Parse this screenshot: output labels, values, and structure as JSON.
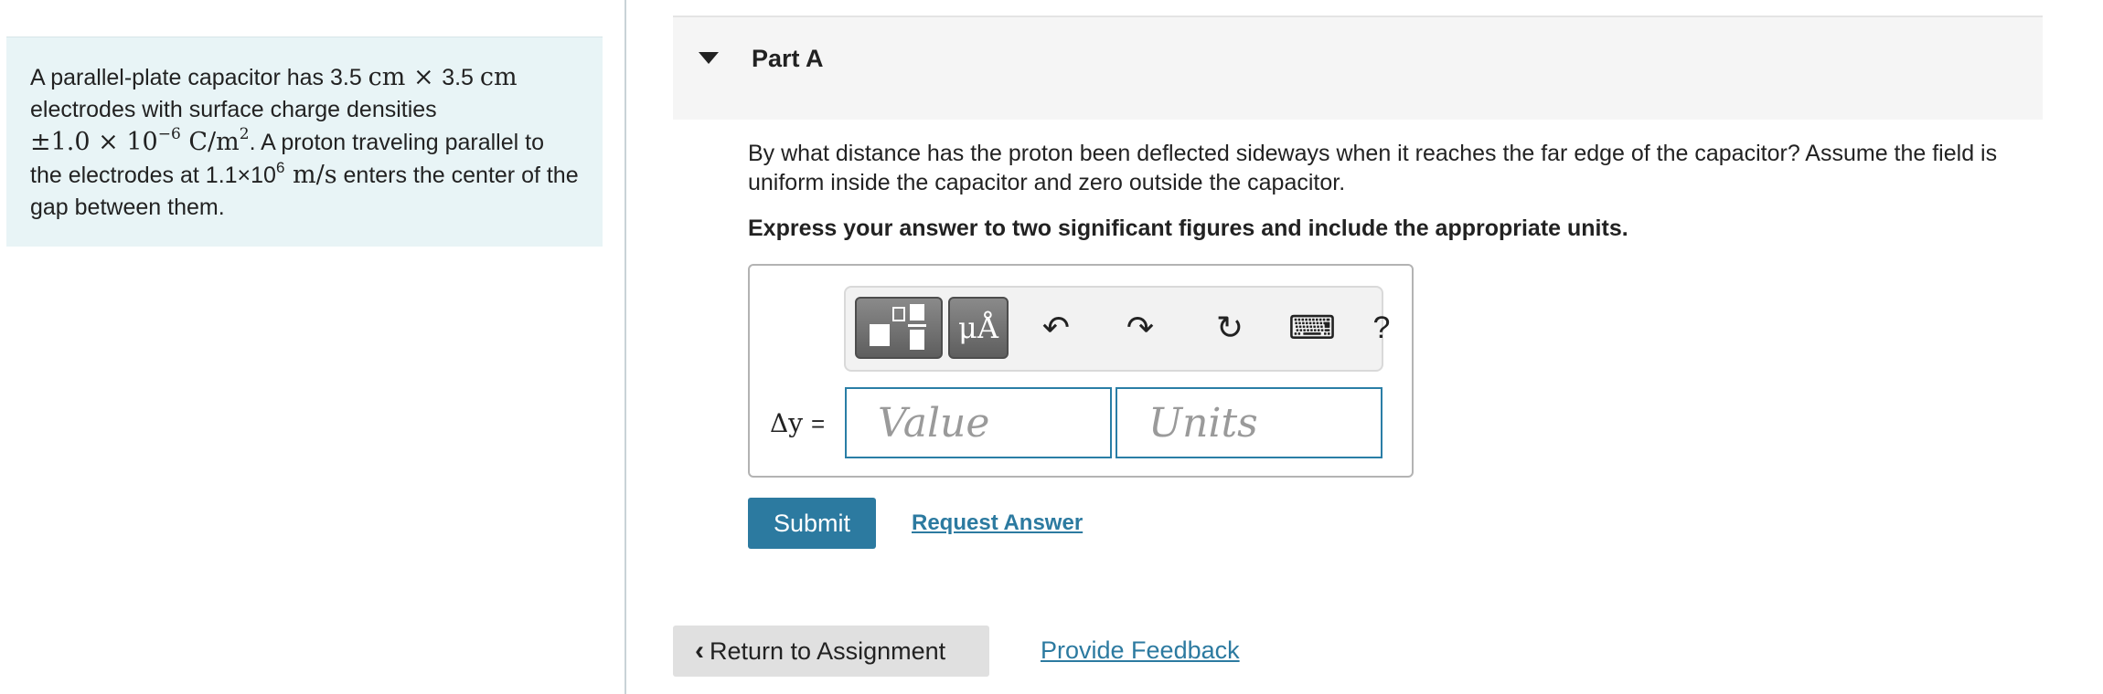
{
  "problem": {
    "text_1": "A parallel-plate capacitor has 3.5 ",
    "unit_cm_1": "cm",
    "times_1": " × ",
    "text_2": "3.5 ",
    "unit_cm_2": "cm",
    "text_3": "electrodes with surface charge densities",
    "charge_density_base": "±1.0 × 10",
    "charge_density_exp": "−6",
    "charge_density_unit": " C/m",
    "charge_density_unit_exp": "2",
    "text_4": ". A proton traveling parallel to the electrodes at 1.1×10",
    "speed_exp": "6",
    "speed_unit": " m/s",
    "text_5": " enters the center of the gap between them."
  },
  "part": {
    "title": "Part A",
    "question": "By what distance has the proton been deflected sideways when it reaches the far edge of the capacitor? Assume the field is uniform inside the capacitor and zero outside the capacitor.",
    "instruction": "Express your answer to two significant figures and include the appropriate units."
  },
  "toolbar": {
    "units_label": "μÅ",
    "undo_symbol": "↶",
    "redo_symbol": "↷",
    "reset_symbol": "↻",
    "keyboard_symbol": "⌨",
    "help_label": "?"
  },
  "answer": {
    "variable_label": "Δy",
    "equals": "=",
    "value_placeholder": "Value",
    "units_placeholder": "Units"
  },
  "actions": {
    "submit_label": "Submit",
    "request_answer_label": "Request Answer",
    "return_label": "Return to Assignment",
    "feedback_label": "Provide Feedback"
  },
  "colors": {
    "accent": "#2c7aa0",
    "panel_bg": "#e8f4f6"
  }
}
